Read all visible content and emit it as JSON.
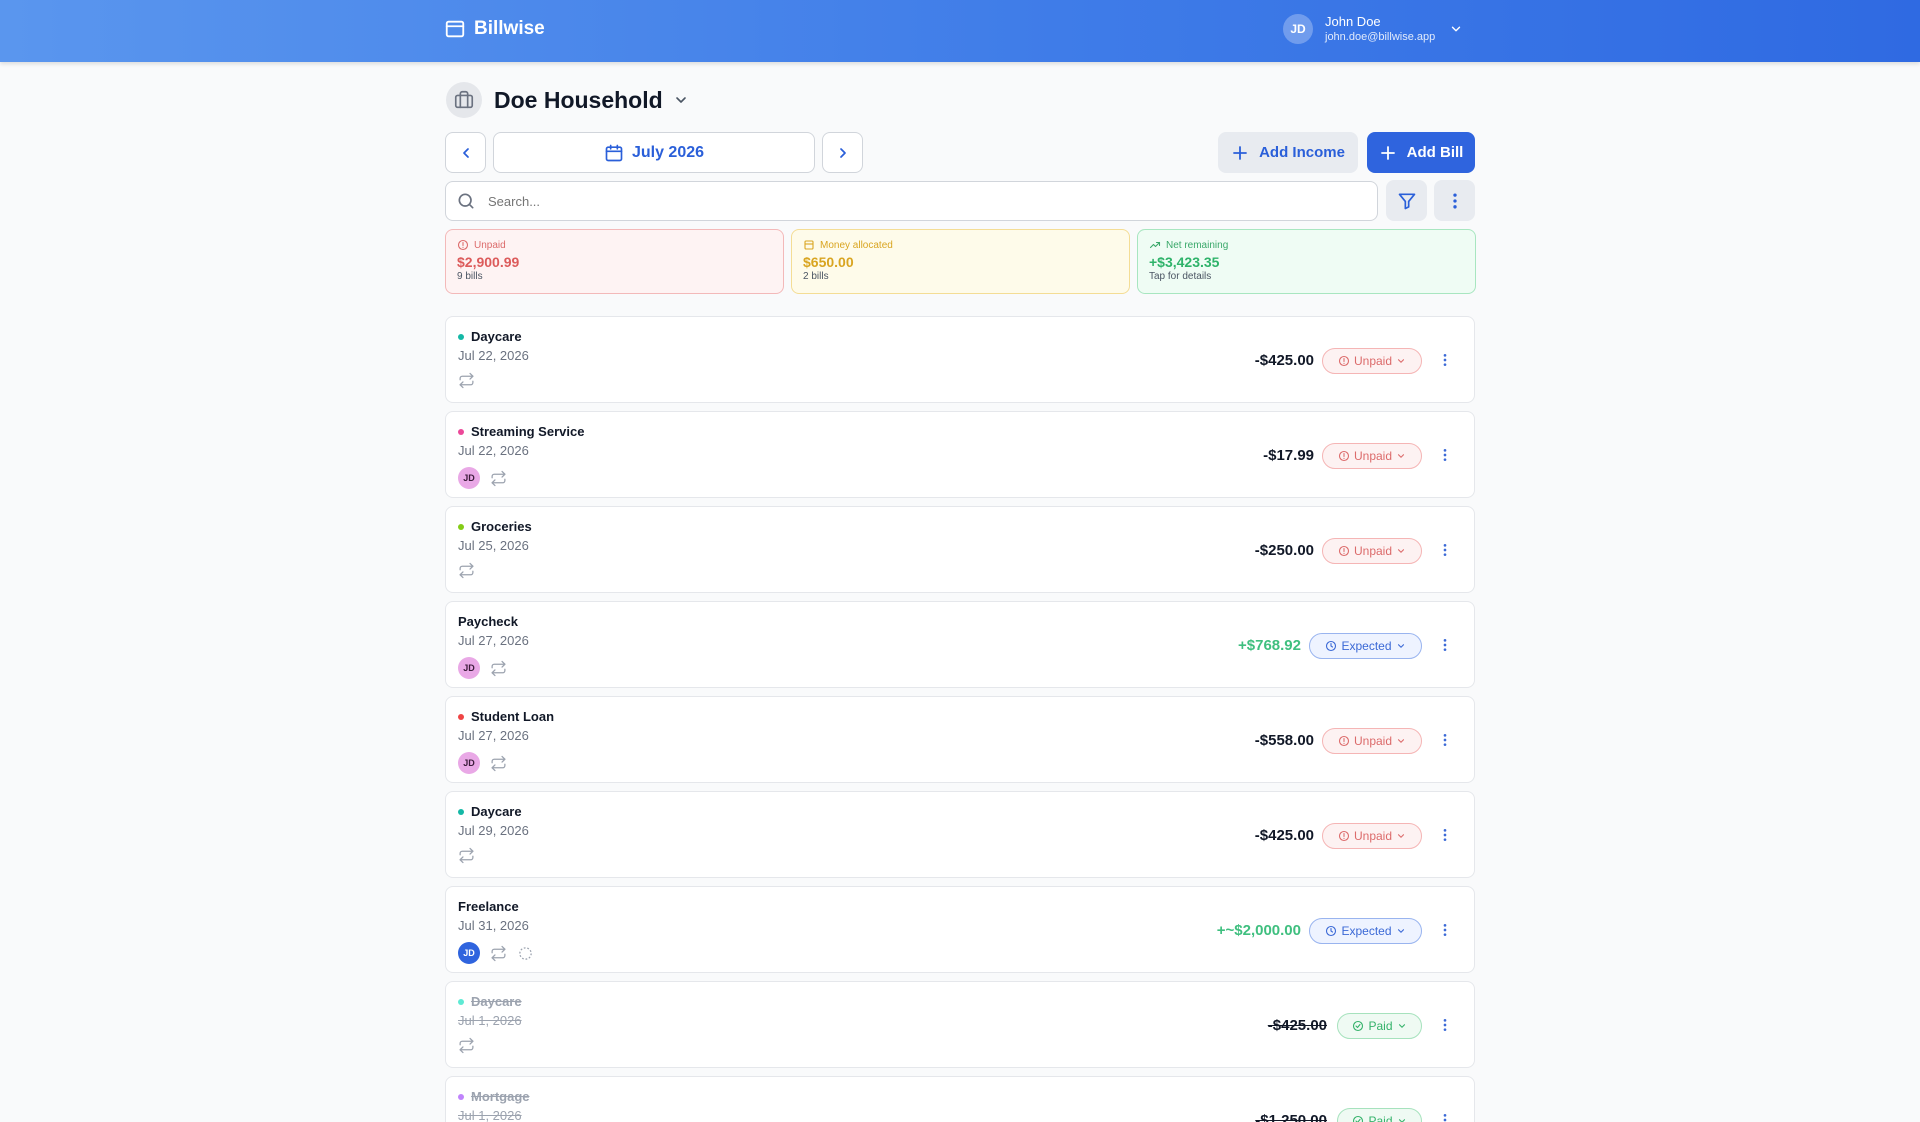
{
  "header": {
    "brand": "Billwise",
    "user_initials": "JD",
    "user_name": "John Doe",
    "user_email": "john.doe@billwise.app"
  },
  "household": {
    "title": "Doe Household"
  },
  "toolbar": {
    "month": "July 2026",
    "add_income": "Add Income",
    "add_bill": "Add Bill",
    "search_placeholder": "Search..."
  },
  "summary": {
    "unpaid": {
      "label": "Unpaid",
      "value": "$2,900.99",
      "sub": "9 bills"
    },
    "allocated": {
      "label": "Money allocated",
      "value": "$650.00",
      "sub": "2 bills"
    },
    "net": {
      "label": "Net remaining",
      "value": "+$3,423.35",
      "sub": "Tap for details"
    }
  },
  "colors": {
    "accent": "#2f64de",
    "unpaid": "#dc6b6b",
    "expected": "#3b69d6",
    "paid": "#34b26a",
    "income": "#3fbf7f"
  },
  "bills": [
    {
      "name": "Daycare",
      "date": "Jul 22, 2026",
      "amount": "-$425.00",
      "status": "Unpaid",
      "dot": "#14b8a6",
      "avatar": null
    },
    {
      "name": "Streaming Service",
      "date": "Jul 22, 2026",
      "amount": "-$17.99",
      "status": "Unpaid",
      "dot": "#ec4899",
      "avatar": "JD"
    },
    {
      "name": "Groceries",
      "date": "Jul 25, 2026",
      "amount": "-$250.00",
      "status": "Unpaid",
      "dot": "#84cc16",
      "avatar": null
    },
    {
      "name": "Paycheck",
      "date": "Jul 27, 2026",
      "amount": "+$768.92",
      "status": "Expected",
      "dot": null,
      "avatar": "JD"
    },
    {
      "name": "Student Loan",
      "date": "Jul 27, 2026",
      "amount": "-$558.00",
      "status": "Unpaid",
      "dot": "#ef4444",
      "avatar": "JD"
    },
    {
      "name": "Daycare",
      "date": "Jul 29, 2026",
      "amount": "-$425.00",
      "status": "Unpaid",
      "dot": "#14b8a6",
      "avatar": null
    },
    {
      "name": "Freelance",
      "date": "Jul 31, 2026",
      "amount": "+~$2,000.00",
      "status": "Expected",
      "dot": null,
      "avatar": "JD"
    },
    {
      "name": "Daycare",
      "date": "Jul 1, 2026",
      "amount": "-$425.00",
      "status": "Paid",
      "dot": "#5eead4",
      "avatar": null
    },
    {
      "name": "Mortgage",
      "date": "Jul 1, 2026",
      "amount": "-$1,250.00",
      "status": "Paid",
      "dot": "#c084fc",
      "avatar": null
    }
  ]
}
